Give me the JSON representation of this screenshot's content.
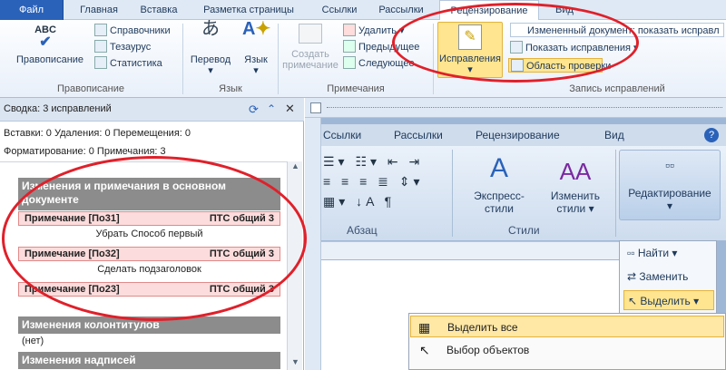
{
  "tabs": [
    "Файл",
    "Главная",
    "Вставка",
    "Разметка страницы",
    "Ссылки",
    "Рассылки",
    "Рецензирование",
    "Вид"
  ],
  "ribbon": {
    "spelling": "Правописание",
    "thesaurus_list": [
      "Справочники",
      "Тезаурус",
      "Статистика"
    ],
    "group_spelling": "Правописание",
    "translate": "Перевод",
    "language": "Язык",
    "group_language": "Язык",
    "create_comment": "Создать примечание",
    "delete": "Удалить",
    "previous": "Предыдущее",
    "next": "Следующее",
    "group_comments": "Примечания",
    "track_changes": "Исправления",
    "display_mode": "Измененный документ: показать исправл",
    "show_markup": "Показать исправления",
    "review_pane": "Область проверки",
    "group_tracking": "Запись исправлений"
  },
  "pane": {
    "summary": "Сводка: 3 исправлений",
    "stats1": "Вставки: 0  Удаления: 0  Перемещения: 0",
    "stats2": "Форматирование: 0  Примечания: 3",
    "main_section": "Изменения и примечания в основном документе",
    "comments": [
      {
        "label": "Примечание [По31]",
        "author": "ПТС общий 3",
        "text": "Убрать Способ первый"
      },
      {
        "label": "Примечание [По32]",
        "author": "ПТС общий 3",
        "text": "Сделать подзаголовок"
      },
      {
        "label": "Примечание [По23]",
        "author": "ПТС общий 3",
        "text": ""
      }
    ],
    "headers_section": "Изменения колонтитулов",
    "none": "(нет)",
    "textbox_section": "Изменения надписей"
  },
  "inner": {
    "tabs": [
      "Ссылки",
      "Рассылки",
      "Рецензирование",
      "Вид"
    ],
    "group_paragraph": "Абзац",
    "express_styles": "Экспресс-стили",
    "change_styles": "Изменить стили",
    "group_styles": "Стили",
    "editing": "Редактирование",
    "find": "Найти",
    "replace": "Заменить",
    "select": "Выделить",
    "select_menu": [
      "Выделить все",
      "Выбор объектов"
    ]
  },
  "colors": {
    "accent": "#2a62b9",
    "highlight": "#ffe58f",
    "oval": "#e0202a"
  }
}
